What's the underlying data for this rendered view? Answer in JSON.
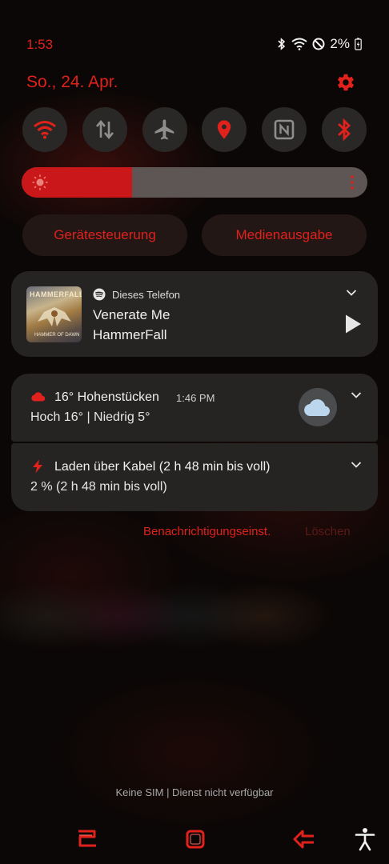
{
  "status_bar": {
    "time": "1:53",
    "battery": "2%",
    "icons": [
      "bluetooth-icon",
      "wifi-icon",
      "do-not-disturb-icon",
      "battery-charging-icon"
    ]
  },
  "header": {
    "date": "So., 24. Apr.",
    "settings_icon": "gear-icon"
  },
  "quick_toggles": [
    {
      "name": "wifi",
      "icon": "wifi-icon",
      "active": true
    },
    {
      "name": "mobile-data",
      "icon": "mobile-data-icon",
      "active": false
    },
    {
      "name": "airplane-mode",
      "icon": "airplane-icon",
      "active": false
    },
    {
      "name": "location",
      "icon": "location-icon",
      "active": true
    },
    {
      "name": "nfc",
      "icon": "nfc-icon",
      "active": false
    },
    {
      "name": "bluetooth",
      "icon": "bluetooth-icon",
      "active": true
    }
  ],
  "brightness": {
    "level": 0.32,
    "icon": "sun-icon",
    "more_icon": "more-vertical-icon"
  },
  "shortcuts": {
    "device_control": "Gerätesteuerung",
    "media_output": "Medienausgabe"
  },
  "media": {
    "source": "Dieses Telefon",
    "title": "Venerate Me",
    "artist": "HammerFall",
    "album_logo": "HAMMERFALL",
    "album_caption": "HAMMER OF DAWN",
    "app_icon": "spotify-icon",
    "play_icon": "play-icon",
    "expand_icon": "chevron-down-icon"
  },
  "notifications": {
    "weather": {
      "title": "16° Hohenstücken",
      "time": "1:46 PM",
      "subtitle": "Hoch 16° | Niedrig 5°",
      "icon": "cloud-icon"
    },
    "charging": {
      "title": "Laden über Kabel (2 h 48 min bis voll)",
      "subtitle": "2 % (2 h 48 min bis voll)",
      "icon": "bolt-icon"
    }
  },
  "actions": {
    "notification_settings": "Benachrichtigungseinst.",
    "clear": "Löschen"
  },
  "footer": {
    "sim_status": "Keine SIM | Dienst nicht verfügbar"
  },
  "nav_bar": {
    "recent_icon": "recent-apps-icon",
    "home_icon": "home-icon",
    "back_icon": "back-icon",
    "accessibility_icon": "accessibility-icon"
  },
  "colors": {
    "accent": "#e0211c",
    "card": "#262423",
    "toggle_bg": "#2a2827",
    "brightness_track": "#5e5655"
  }
}
